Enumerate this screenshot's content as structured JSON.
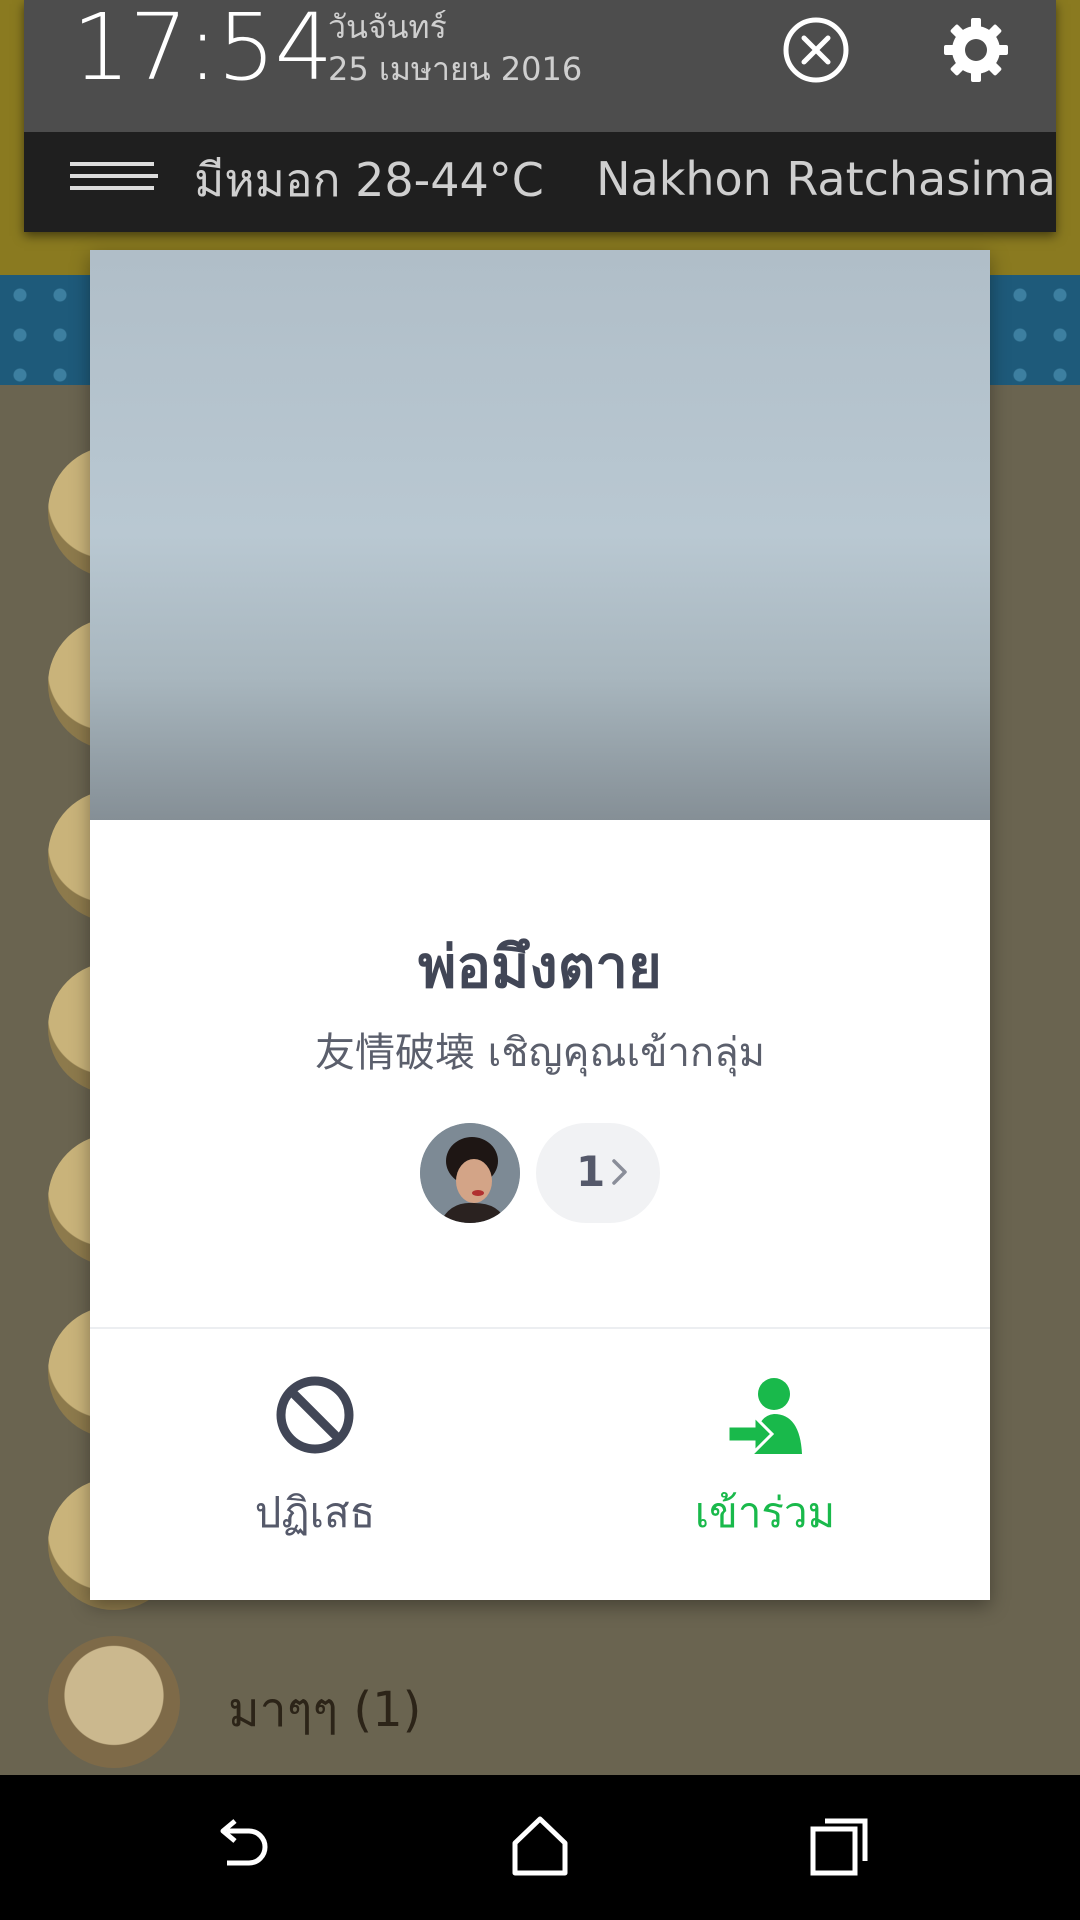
{
  "notification": {
    "time": "17:54",
    "day": "วันจันทร์",
    "date": "25 เมษายน 2016",
    "close_icon": "close-circle-icon",
    "settings_icon": "gear-icon",
    "weather": {
      "icon": "fog-icon",
      "condition_temp": "มีหมอก 28-44°C",
      "city": "Nakhon Ratchasima"
    }
  },
  "background_app": {
    "last_chat_title": "มาๆๆ (1)"
  },
  "dialog": {
    "group_name": "พ่อมึงตาย",
    "invite_text": "友情破壊 เชิญคุณเข้ากลุ่ม",
    "member_count": "1",
    "decline_label": "ปฏิเสธ",
    "join_label": "เข้าร่วม",
    "decline_icon": "block-icon",
    "join_icon": "join-person-icon",
    "colors": {
      "join_green": "#19b94b",
      "decline_gray": "#414656"
    }
  },
  "navbar": {
    "back_icon": "back-icon",
    "home_icon": "home-icon",
    "recent_icon": "recent-apps-icon"
  }
}
